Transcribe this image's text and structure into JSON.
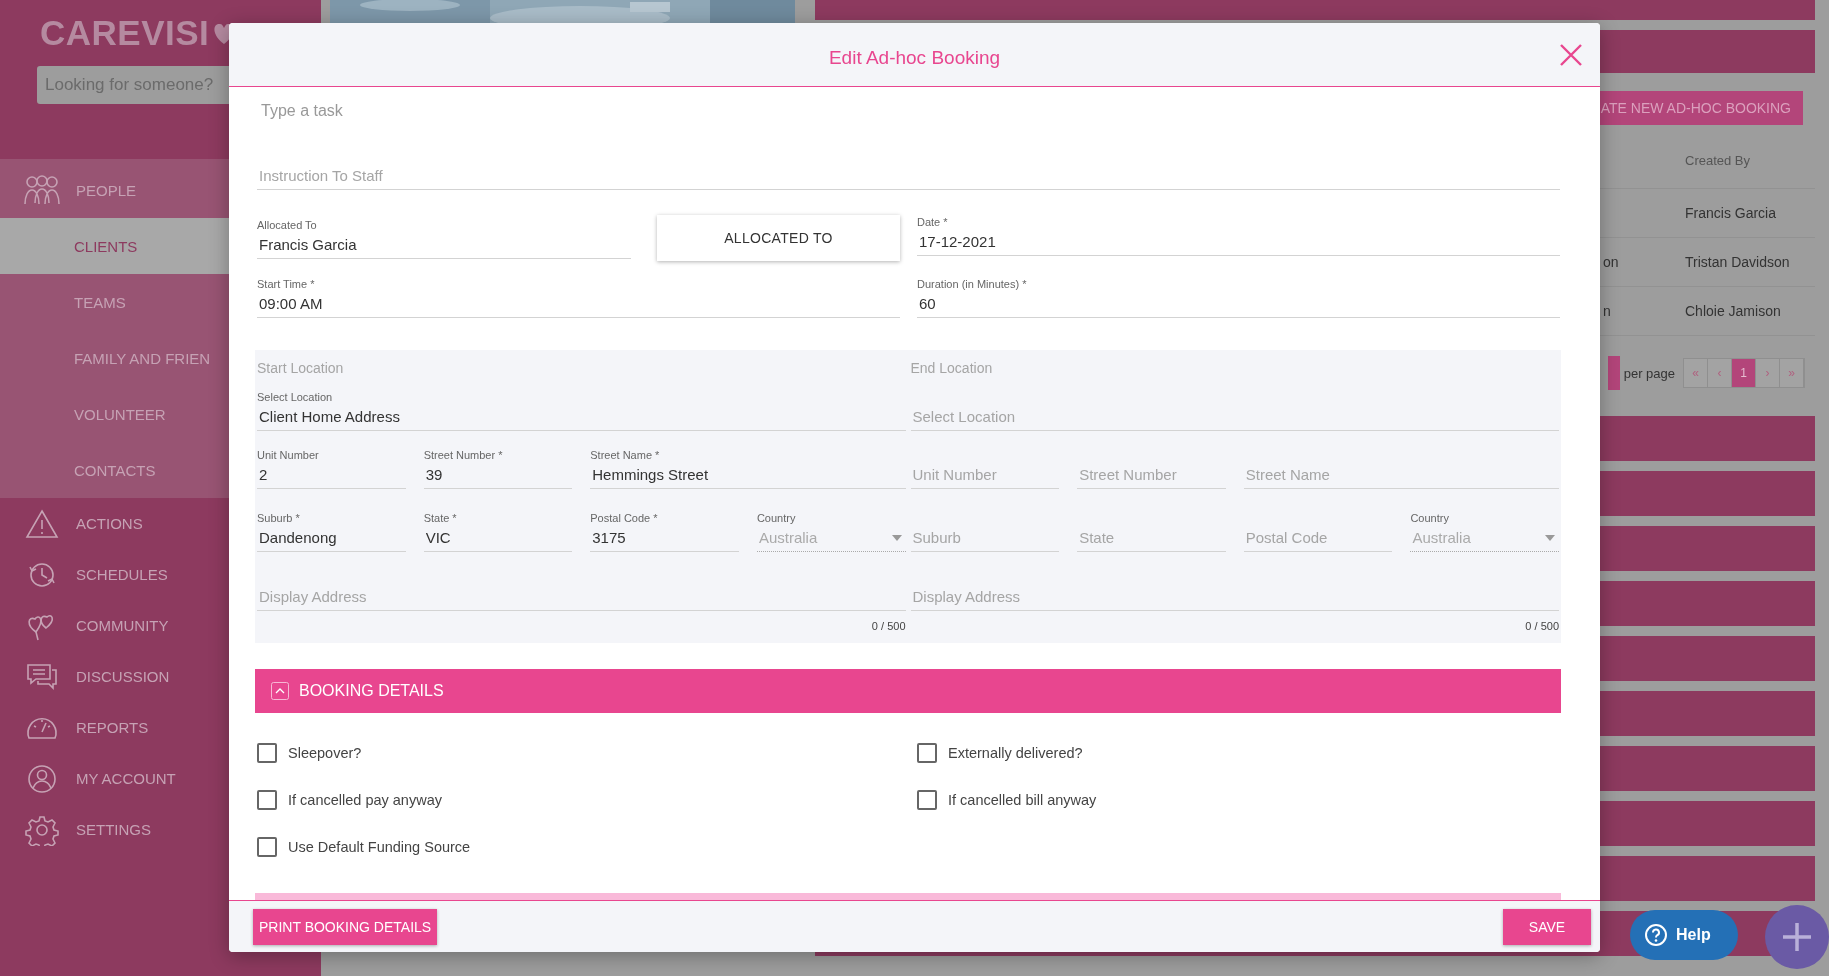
{
  "sidebar": {
    "logo": "CAREVISI",
    "search": {
      "placeholder": "Looking for someone?"
    },
    "nav": [
      {
        "label": "PEOPLE",
        "selected": false,
        "children": [
          {
            "label": "CLIENTS",
            "selected": true
          },
          {
            "label": "TEAMS",
            "selected": false
          },
          {
            "label": "FAMILY AND FRIEN",
            "selected": false
          },
          {
            "label": "VOLUNTEER",
            "selected": false
          },
          {
            "label": "CONTACTS",
            "selected": false
          }
        ]
      },
      {
        "label": "ACTIONS",
        "selected": false
      },
      {
        "label": "SCHEDULES",
        "selected": false
      },
      {
        "label": "COMMUNITY",
        "selected": false
      },
      {
        "label": "DISCUSSION",
        "selected": false
      },
      {
        "label": "REPORTS",
        "selected": false
      },
      {
        "label": "MY ACCOUNT",
        "selected": false
      },
      {
        "label": "SETTINGS",
        "selected": false
      }
    ]
  },
  "page": {
    "create_button": "ATE NEW AD-HOC BOOKING",
    "table": {
      "columns": [
        "Created By"
      ],
      "rows": [
        {
          "created_by": "Francis Garcia"
        },
        {
          "column_1": "on",
          "created_by": "Tristan Davidson"
        },
        {
          "column_1": "n",
          "created_by": "Chloie Jamison"
        }
      ]
    },
    "pagination": {
      "label": "per page",
      "pages": [
        {
          "label": "«",
          "selected": false
        },
        {
          "label": "‹",
          "selected": false
        },
        {
          "label": "1",
          "selected": true
        },
        {
          "label": "›",
          "selected": false
        },
        {
          "label": "»",
          "selected": false
        }
      ]
    },
    "help_button": "Help"
  },
  "modal": {
    "title": "Edit Ad-hoc Booking",
    "tasks": {
      "placeholder": "Type a task"
    },
    "instruction": {
      "placeholder": "Instruction To Staff"
    },
    "allocated_to": {
      "label": "Allocated To",
      "value": "Francis Garcia"
    },
    "allocate_button": "ALLOCATED TO",
    "date": {
      "label": "Date *",
      "value": "17-12-2021"
    },
    "start_time": {
      "label": "Start Time *",
      "value": "09:00 AM"
    },
    "duration": {
      "label": "Duration (in Minutes) *",
      "value": "60"
    },
    "locations": [
      {
        "heading": "Start Location",
        "select": {
          "label": "Select Location",
          "value": "Client Home Address"
        },
        "address_rows": [
          [
            {
              "kind": "text",
              "label": "Unit Number",
              "value": "2",
              "disabled": false
            },
            {
              "kind": "text",
              "label": "Street Number *",
              "value": "39",
              "disabled": false
            },
            {
              "kind": "text",
              "label": "Street Name *",
              "value": "Hemmings Street",
              "disabled": false
            }
          ],
          [
            {
              "kind": "text",
              "label": "Suburb *",
              "value": "Dandenong",
              "disabled": false
            },
            {
              "kind": "text",
              "label": "State *",
              "value": "VIC",
              "disabled": false
            },
            {
              "kind": "text",
              "label": "Postal Code *",
              "value": "3175",
              "disabled": false
            },
            {
              "kind": "select",
              "label": "Country",
              "value": "Australia",
              "disabled": true
            }
          ]
        ],
        "display_address": {
          "placeholder": "Display Address",
          "counter": "0 / 500"
        }
      },
      {
        "heading": "End Location",
        "select": {
          "placeholder": "Select Location"
        },
        "address_rows": [
          [
            {
              "kind": "text",
              "placeholder": "Unit Number",
              "disabled": false
            },
            {
              "kind": "text",
              "placeholder": "Street Number",
              "disabled": false
            },
            {
              "kind": "text",
              "placeholder": "Street Name",
              "disabled": false
            }
          ],
          [
            {
              "kind": "text",
              "placeholder": "Suburb",
              "disabled": false
            },
            {
              "kind": "text",
              "placeholder": "State",
              "disabled": false
            },
            {
              "kind": "text",
              "placeholder": "Postal Code",
              "disabled": false
            },
            {
              "kind": "select",
              "label": "Country",
              "value": "Australia",
              "disabled": true
            }
          ]
        ],
        "display_address": {
          "placeholder": "Display Address",
          "counter": "0 / 500"
        }
      }
    ],
    "booking_details": {
      "title": "BOOKING DETAILS",
      "expanded": true,
      "options": [
        {
          "label": "Sleepover?",
          "checked": false
        },
        {
          "label": "Externally delivered?",
          "checked": false
        },
        {
          "label": "If cancelled pay anyway",
          "checked": false
        },
        {
          "label": "If cancelled bill anyway",
          "checked": false
        },
        {
          "label": "Use Default Funding Source",
          "checked": false
        }
      ]
    },
    "print_button": "PRINT BOOKING DETAILS",
    "save_button": "SAVE"
  }
}
